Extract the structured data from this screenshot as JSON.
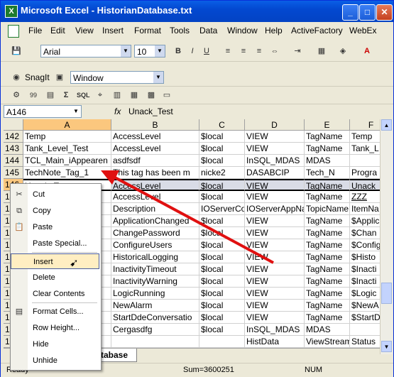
{
  "window": {
    "title": "Microsoft Excel - HistorianDatabase.txt"
  },
  "menu": [
    "File",
    "Edit",
    "View",
    "Insert",
    "Format",
    "Tools",
    "Data",
    "Window",
    "Help",
    "ActiveFactory",
    "WebEx"
  ],
  "toolbar": {
    "font": "Arial",
    "size": "10",
    "snagit": "SnagIt",
    "window_select": "Window"
  },
  "formula": {
    "name_box": "A146",
    "fx": "fx",
    "value": "Unack_Test"
  },
  "columns": [
    "A",
    "B",
    "C",
    "D",
    "E",
    "F"
  ],
  "rows": [
    {
      "num": "142",
      "a": "Temp",
      "b": "AccessLevel",
      "c": "$local",
      "d": "VIEW",
      "e": "TagName",
      "f": "Temp"
    },
    {
      "num": "143",
      "a": "Tank_Level_Test",
      "b": "AccessLevel",
      "c": "$local",
      "d": "VIEW",
      "e": "TagName",
      "f": "Tank_L"
    },
    {
      "num": "144",
      "a": "TCL_Main_iAppearen",
      "b": "asdfsdf",
      "c": "$local",
      "d": "InSQL_MDAS",
      "e": "MDAS",
      "f": ""
    },
    {
      "num": "145",
      "a": "TechNote_Tag_1",
      "b": "This tag has been m",
      "c": "nicke2",
      "d": "DASABCIP",
      "e": "Tech_N",
      "f": "Progra"
    },
    {
      "num": "146",
      "a": "Unack_Test",
      "b": "AccessLevel",
      "c": "$local",
      "d": "VIEW",
      "e": "TagName",
      "f": "Unack"
    },
    {
      "num": "147",
      "a": "",
      "b": "AccessLevel",
      "c": "$local",
      "d": "VIEW",
      "e": "TagName",
      "f": "ZZZ"
    },
    {
      "num": "148",
      "a": "lar",
      "b": "Description",
      "c": "IOServerCo",
      "d": "IOServerAppNa",
      "e": "TopicName",
      "f": "ItemNa"
    },
    {
      "num": "149",
      "a": "ed",
      "b": "ApplicationChanged",
      "c": "$local",
      "d": "VIEW",
      "e": "TagName",
      "f": "$Applic"
    },
    {
      "num": "150",
      "a": "",
      "b": "ChangePassword",
      "c": "$local",
      "d": "VIEW",
      "e": "TagName",
      "f": "$Chan"
    },
    {
      "num": "151",
      "a": "",
      "b": "ConfigureUsers",
      "c": "$local",
      "d": "VIEW",
      "e": "TagName",
      "f": "$Config"
    },
    {
      "num": "152",
      "a": "",
      "b": "HistoricalLogging",
      "c": "$local",
      "d": "VIEW",
      "e": "TagName",
      "f": "$Histo"
    },
    {
      "num": "153",
      "a": "",
      "b": "InactivityTimeout",
      "c": "$local",
      "d": "VIEW",
      "e": "TagName",
      "f": "$Inacti"
    },
    {
      "num": "154",
      "a": "",
      "b": "InactivityWarning",
      "c": "$local",
      "d": "VIEW",
      "e": "TagName",
      "f": "$Inacti"
    },
    {
      "num": "155",
      "a": "",
      "b": "LogicRunning",
      "c": "$local",
      "d": "VIEW",
      "e": "TagName",
      "f": "$Logic"
    },
    {
      "num": "156",
      "a": "",
      "b": "NewAlarm",
      "c": "$local",
      "d": "VIEW",
      "e": "TagName",
      "f": "$NewA"
    },
    {
      "num": "157",
      "a": "ati",
      "b": "StartDdeConversatio",
      "c": "$local",
      "d": "VIEW",
      "e": "TagName",
      "f": "$StartD"
    },
    {
      "num": "158",
      "a": "k",
      "b": "Cergasdfg",
      "c": "$local",
      "d": "InSQL_MDAS",
      "e": "MDAS",
      "f": ""
    },
    {
      "num": "159",
      "a": "",
      "b": "",
      "c": "",
      "d": "HistData",
      "e": "ViewStream",
      "f": "Status"
    }
  ],
  "sheet_tab": "database",
  "status": {
    "ready": "Ready",
    "sum": "Sum=3600251",
    "num": "NUM"
  },
  "context_menu": [
    "Cut",
    "Copy",
    "Paste",
    "Paste Special...",
    "Insert",
    "Delete",
    "Clear Contents",
    "Format Cells...",
    "Row Height...",
    "Hide",
    "Unhide"
  ],
  "colors": {
    "title_blue": "#0348d0",
    "arrow_red": "#e01010",
    "highlight": "#ffeec2"
  }
}
